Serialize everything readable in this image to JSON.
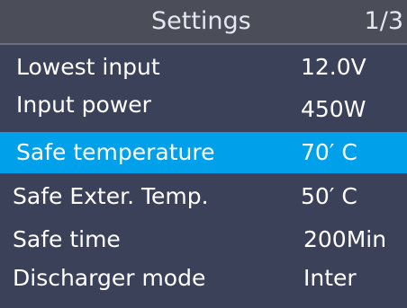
{
  "header": {
    "title": "Settings",
    "page": "1/3"
  },
  "menu": {
    "items": [
      {
        "label": "Lowest input",
        "value": "12.0V",
        "selected": false
      },
      {
        "label": "Input power",
        "value": "450W",
        "selected": false
      },
      {
        "label": "Safe temperature",
        "value": "70′ C",
        "selected": true
      },
      {
        "label": "Safe Exter. Temp.",
        "value": "50′ C",
        "selected": false
      },
      {
        "label": "Safe time",
        "value": "200Min",
        "selected": false
      },
      {
        "label": "Discharger mode",
        "value": "Inter",
        "selected": false
      }
    ]
  },
  "colors": {
    "background": "#3b4159",
    "header": "#4b4d59",
    "highlight": "#00a0ea",
    "text": "#ffffff"
  }
}
